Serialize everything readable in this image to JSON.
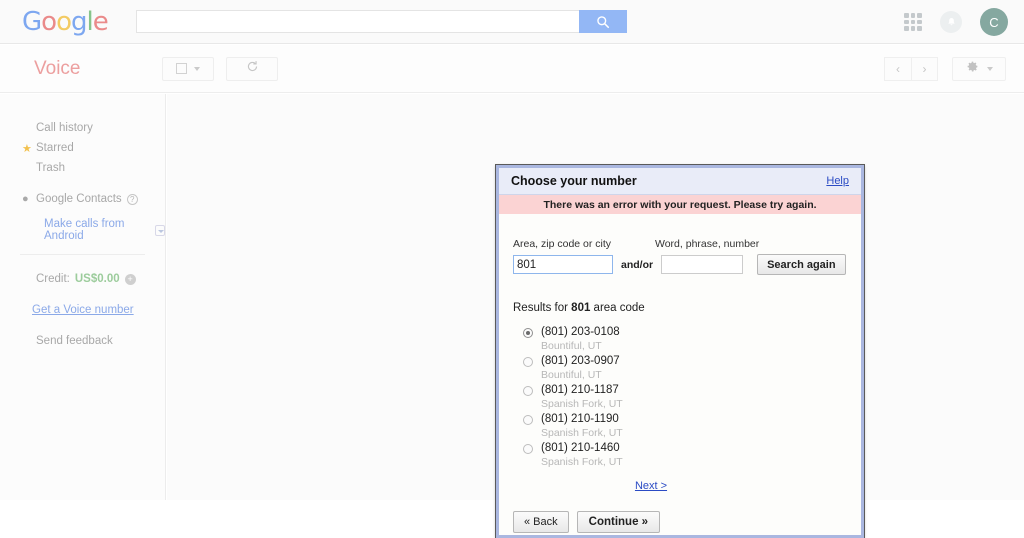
{
  "gbar": {
    "logo_letters": [
      "G",
      "o",
      "o",
      "g",
      "l",
      "e"
    ],
    "search_value": "",
    "search_placeholder": "",
    "search_icon": "search-icon",
    "apps_icon": "apps-grid-icon",
    "notifications_icon": "bell-icon",
    "avatar_letter": "C"
  },
  "voicebar": {
    "product_name": "Voice",
    "select_all_label": "",
    "refresh_label": "↻",
    "prev_label": "‹",
    "next_label": "›",
    "gear_icon": "gear-icon"
  },
  "sidebar": {
    "items": [
      {
        "label": "Call history",
        "icon": "none"
      },
      {
        "label": "Starred",
        "icon": "star-icon"
      },
      {
        "label": "Trash",
        "icon": "none"
      },
      {
        "label": "Google Contacts",
        "icon": "person-icon",
        "help": "?"
      }
    ],
    "android_link": "Make calls from Android",
    "credit_label": "Credit:",
    "credit_value": "US$0.00",
    "add_credit_icon": "plus-circle-icon",
    "get_number_link": "Get a Voice number",
    "send_feedback": "Send feedback"
  },
  "dialog": {
    "title": "Choose your number",
    "help_label": "Help",
    "error_message": "There was an error with your request. Please try again.",
    "label_area": "Area, zip code or city",
    "label_word": "Word, phrase, number",
    "area_value": "801",
    "word_value": "",
    "andor_label": "and/or",
    "search_again_label": "Search again",
    "results_prefix": "Results for ",
    "results_code": "801",
    "results_suffix": " area code",
    "results": [
      {
        "number": "(801) 203-0108",
        "city": "Bountiful, UT",
        "selected": true
      },
      {
        "number": "(801) 203-0907",
        "city": "Bountiful, UT",
        "selected": false
      },
      {
        "number": "(801) 210-1187",
        "city": "Spanish Fork, UT",
        "selected": false
      },
      {
        "number": "(801) 210-1190",
        "city": "Spanish Fork, UT",
        "selected": false
      },
      {
        "number": "(801) 210-1460",
        "city": "Spanish Fork, UT",
        "selected": false
      }
    ],
    "next_label": "Next >",
    "back_label": "« Back",
    "continue_label": "Continue »"
  },
  "colors": {
    "accent_blue": "#93b7f5",
    "dialog_border": "#aab7e0",
    "dialog_header": "#e9ecf8",
    "error_bg": "#fbd3d3",
    "voice_red": "#ec9f9f",
    "credit_green": "#9ccc9c",
    "link_blue": "#2b4bc4",
    "selection_blue": "#3390ff",
    "avatar_bg": "#85a8a0"
  }
}
